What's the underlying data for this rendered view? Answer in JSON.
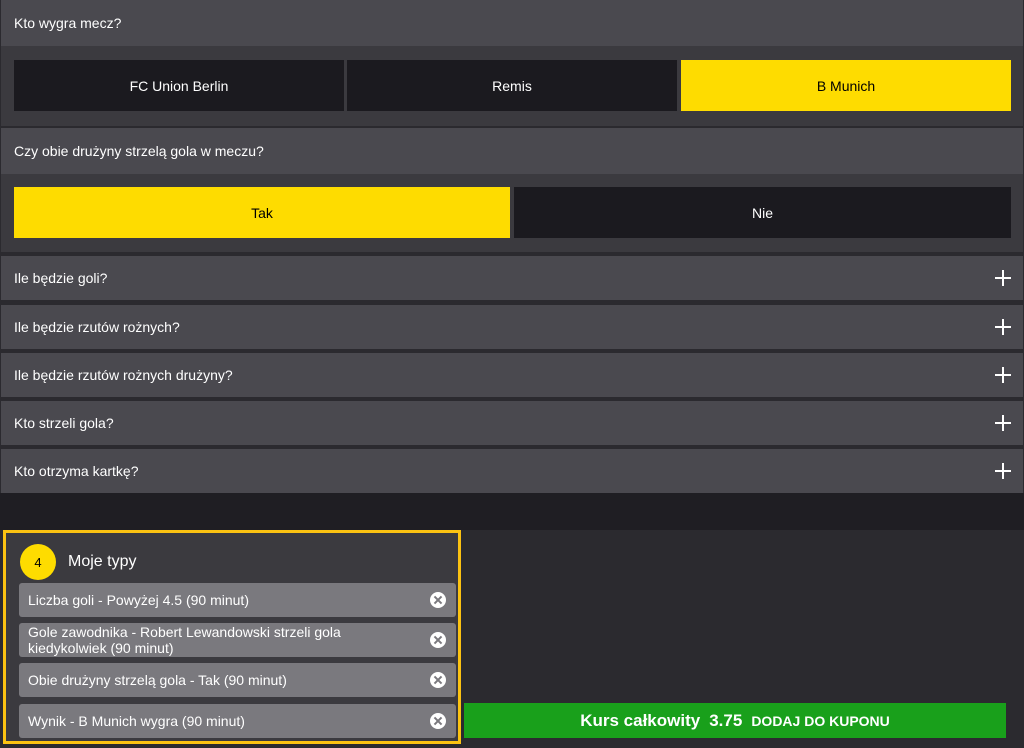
{
  "q1": {
    "title": "Kto wygra mecz?",
    "options": [
      "FC Union Berlin",
      "Remis",
      "B Munich"
    ],
    "selected": "B Munich"
  },
  "q2": {
    "title": "Czy obie drużyny strzelą gola w meczu?",
    "options": [
      "Tak",
      "Nie"
    ],
    "selected": "Tak"
  },
  "collapsed": [
    "Ile będzie goli?",
    "Ile będzie rzutów rożnych?",
    "Ile będzie rzutów rożnych drużyny?",
    "Kto strzeli gola?",
    "Kto otrzyma kartkę?"
  ],
  "tips": {
    "count": "4",
    "title": "Moje typy",
    "items": [
      "Liczba goli - Powyżej 4.5 (90 minut)",
      "Gole zawodnika - Robert Lewandowski strzeli gola kiedykolwiek (90 minut)",
      "Obie drużyny strzelą gola - Tak (90 minut)",
      "Wynik - B Munich wygra (90 minut)"
    ]
  },
  "total": {
    "label": "Kurs całkowity",
    "odds": "3.75",
    "add_label": "DODAJ DO KUPONU"
  },
  "icons": {
    "expand": "plus-icon",
    "remove": "close-circle-icon"
  },
  "colors": {
    "selected": "#fedc00",
    "accent_border": "#fbc212",
    "cta": "#19a01b"
  }
}
